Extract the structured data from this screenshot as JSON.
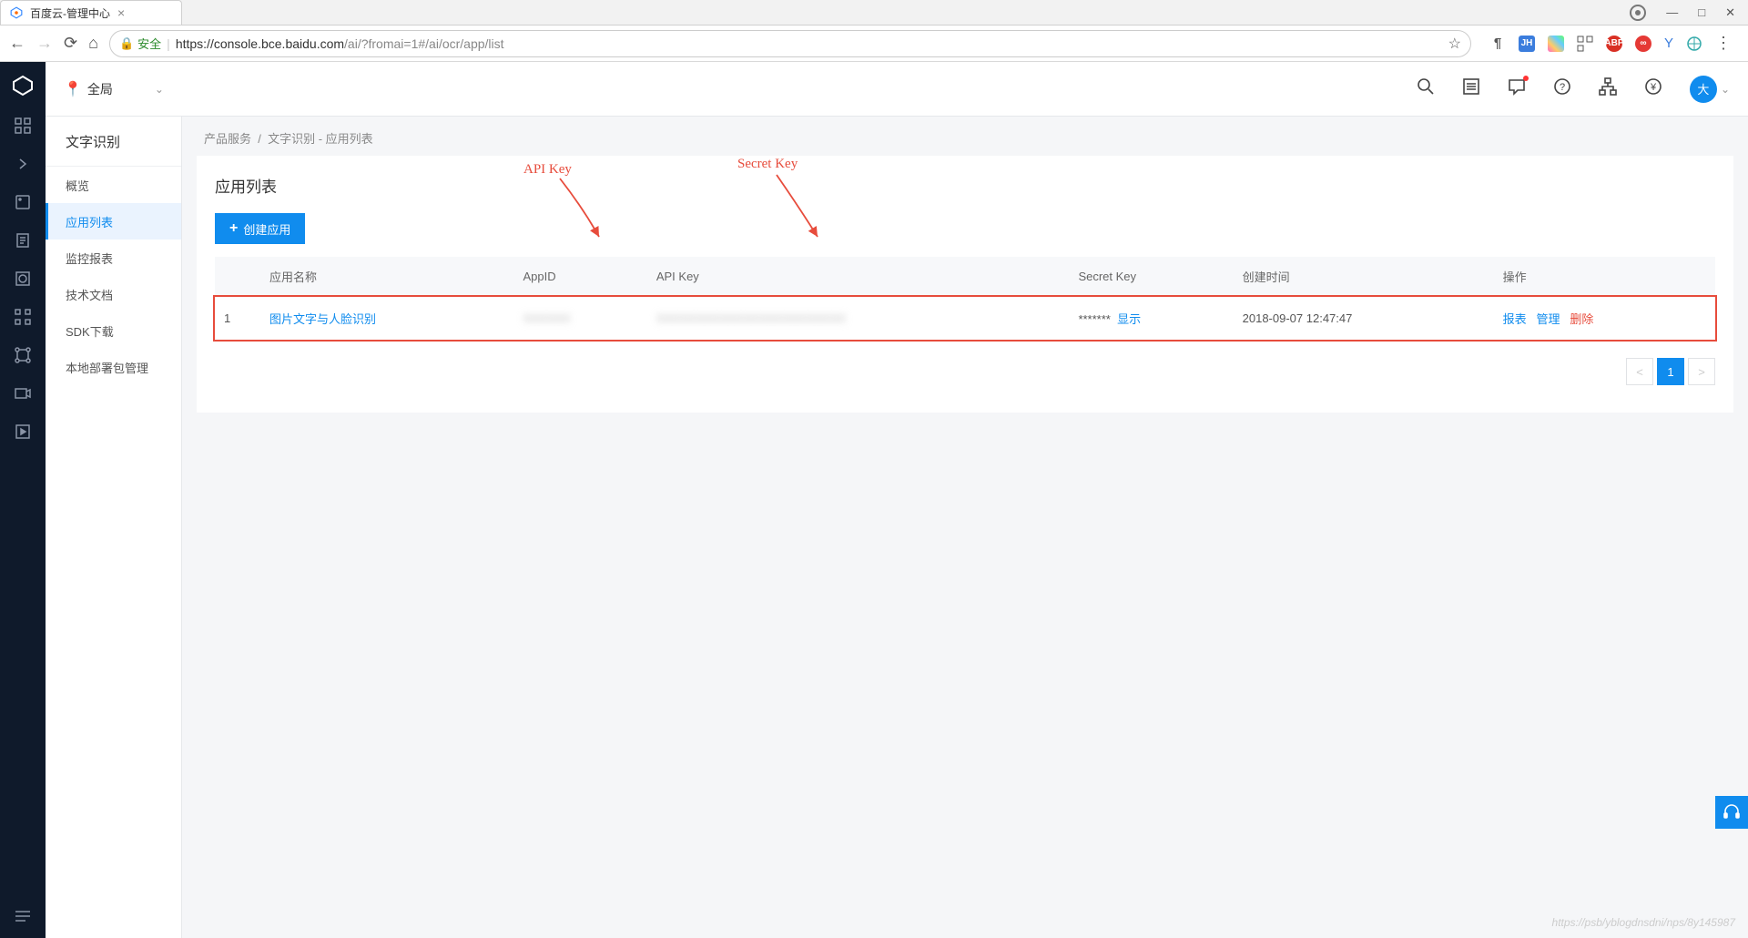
{
  "browser": {
    "tab_title": "百度云-管理中心",
    "secure_label": "安全",
    "url_host": "https://console.bce.baidu.com",
    "url_path": "/ai/?fromai=1#/ai/ocr/app/list"
  },
  "topbar": {
    "region_label": "全局",
    "avatar_text": "大"
  },
  "sidebar": {
    "title": "文字识别",
    "items": [
      {
        "label": "概览"
      },
      {
        "label": "应用列表"
      },
      {
        "label": "监控报表"
      },
      {
        "label": "技术文档"
      },
      {
        "label": "SDK下载"
      },
      {
        "label": "本地部署包管理"
      }
    ],
    "active_index": 1
  },
  "breadcrumb": {
    "root": "产品服务",
    "leaf": "文字识别 - 应用列表"
  },
  "panel": {
    "title": "应用列表",
    "create_label": "创建应用"
  },
  "table": {
    "columns": {
      "name": "应用名称",
      "appid": "AppID",
      "apikey": "API Key",
      "secret": "Secret Key",
      "created": "创建时间",
      "ops": "操作"
    },
    "rows": [
      {
        "index": "1",
        "name": "图片文字与人脸识别",
        "appid_masked": "XXXXXX",
        "apikey_masked": "XXXXXXXXXXXXXXXXXXXXXXXX",
        "secret_masked": "*******",
        "secret_show": "显示",
        "created": "2018-09-07 12:47:47",
        "op_report": "报表",
        "op_manage": "管理",
        "op_delete": "删除"
      }
    ]
  },
  "pagination": {
    "prev": "<",
    "next": ">",
    "current": "1"
  },
  "annotations": {
    "apikey": "API Key",
    "secret": "Secret Key"
  },
  "watermark": "https://psb/yblogdnsdni/nps/8y145987"
}
